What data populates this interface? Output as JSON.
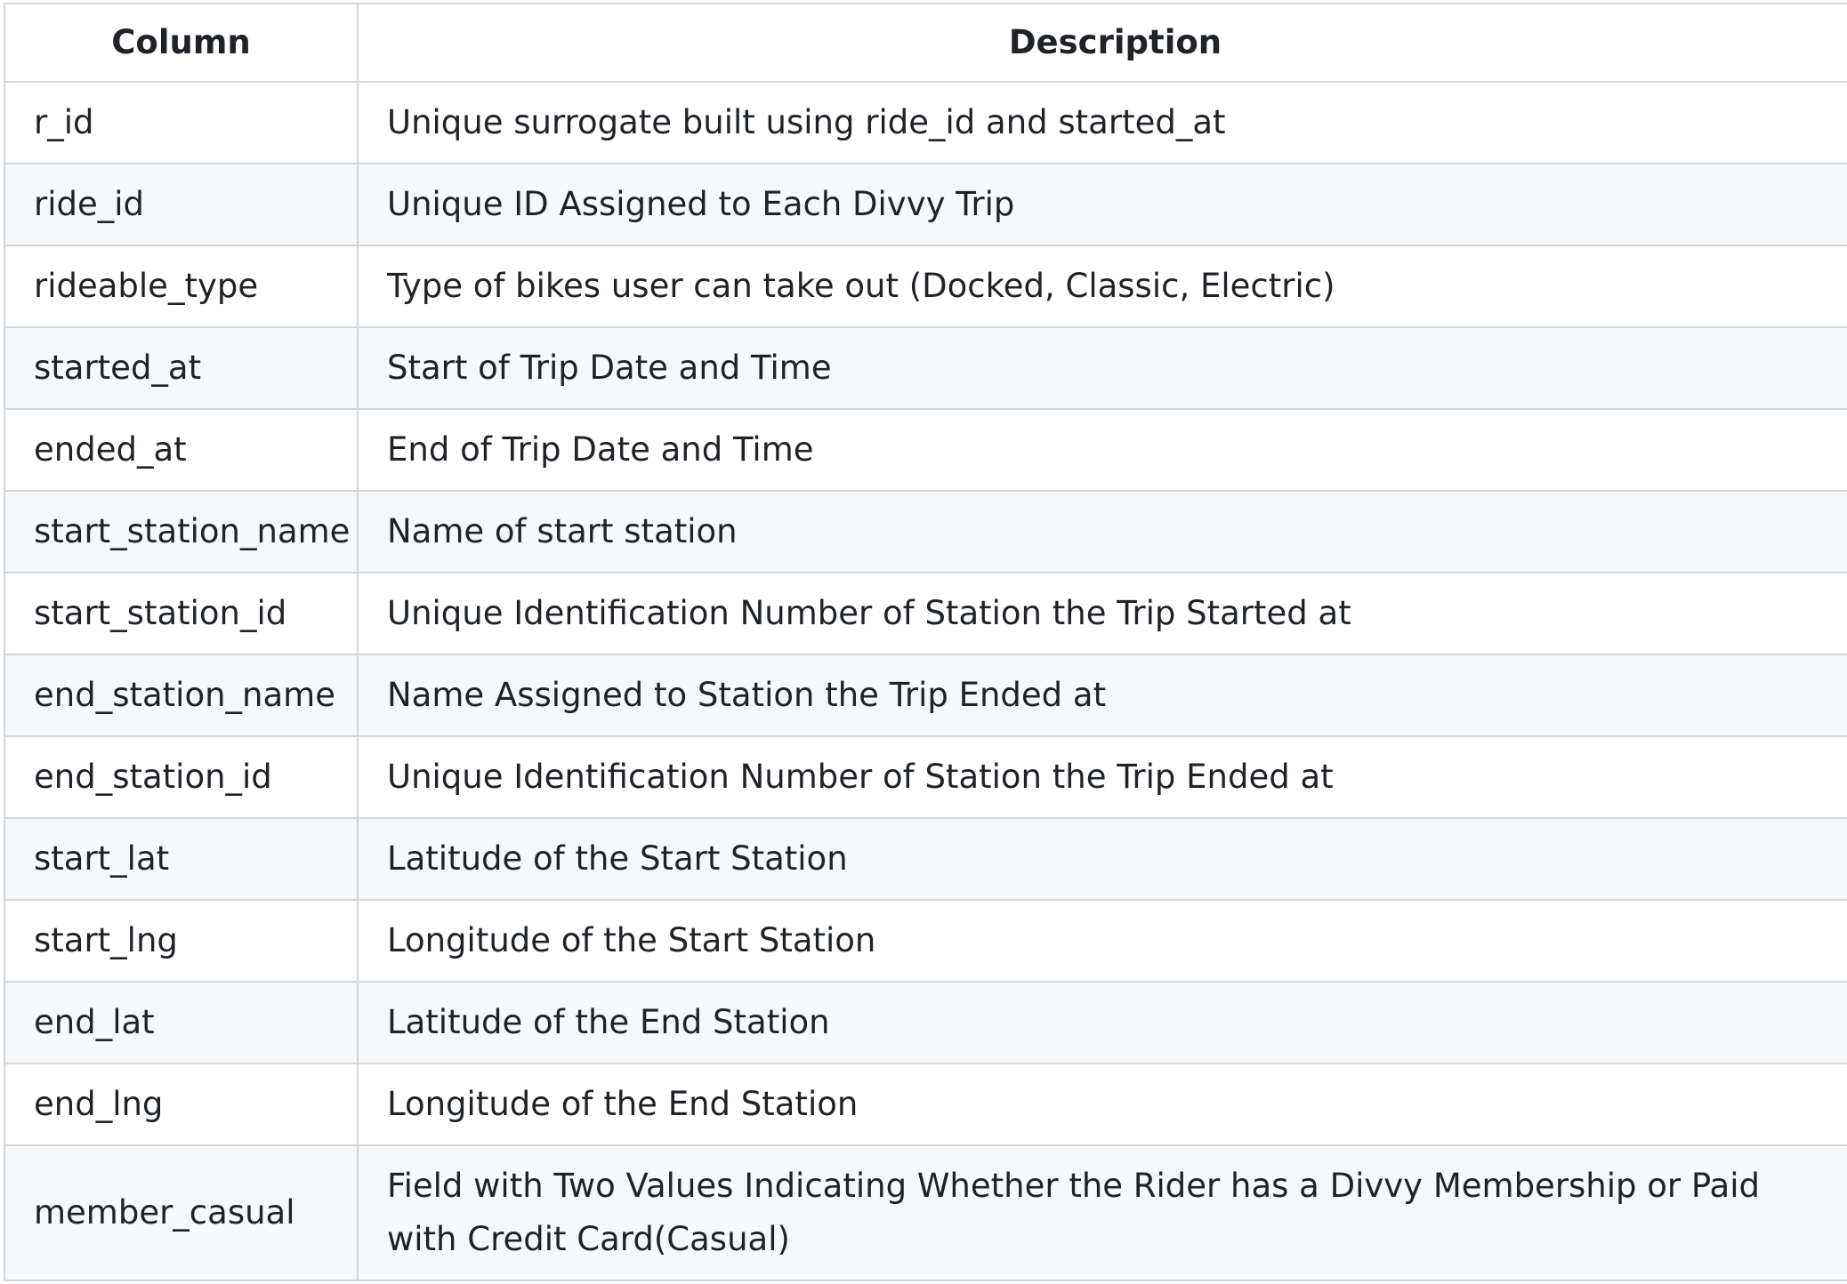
{
  "table": {
    "headers": [
      "Column",
      "Description"
    ],
    "rows": [
      [
        "r_id",
        "Unique surrogate built using ride_id and started_at"
      ],
      [
        "ride_id",
        "Unique ID Assigned to Each Divvy Trip"
      ],
      [
        "rideable_type",
        "Type of bikes user can take out (Docked, Classic, Electric)"
      ],
      [
        "started_at",
        "Start of Trip Date and Time"
      ],
      [
        "ended_at",
        "End of Trip Date and Time"
      ],
      [
        "start_station_name",
        "Name of start station"
      ],
      [
        "start_station_id",
        "Unique Identification Number of Station the Trip Started at"
      ],
      [
        "end_station_name",
        "Name Assigned to Station the Trip Ended at"
      ],
      [
        "end_station_id",
        "Unique Identification Number of Station the Trip Ended at"
      ],
      [
        "start_lat",
        "Latitude of the Start Station"
      ],
      [
        "start_lng",
        "Longitude of the Start Station"
      ],
      [
        "end_lat",
        "Latitude of the End Station"
      ],
      [
        "end_lng",
        "Longitude of the End Station"
      ],
      [
        "member_casual",
        "Field with Two Values Indicating Whether the Rider has a Divvy Membership or Paid with Credit Card(Casual)"
      ]
    ]
  }
}
